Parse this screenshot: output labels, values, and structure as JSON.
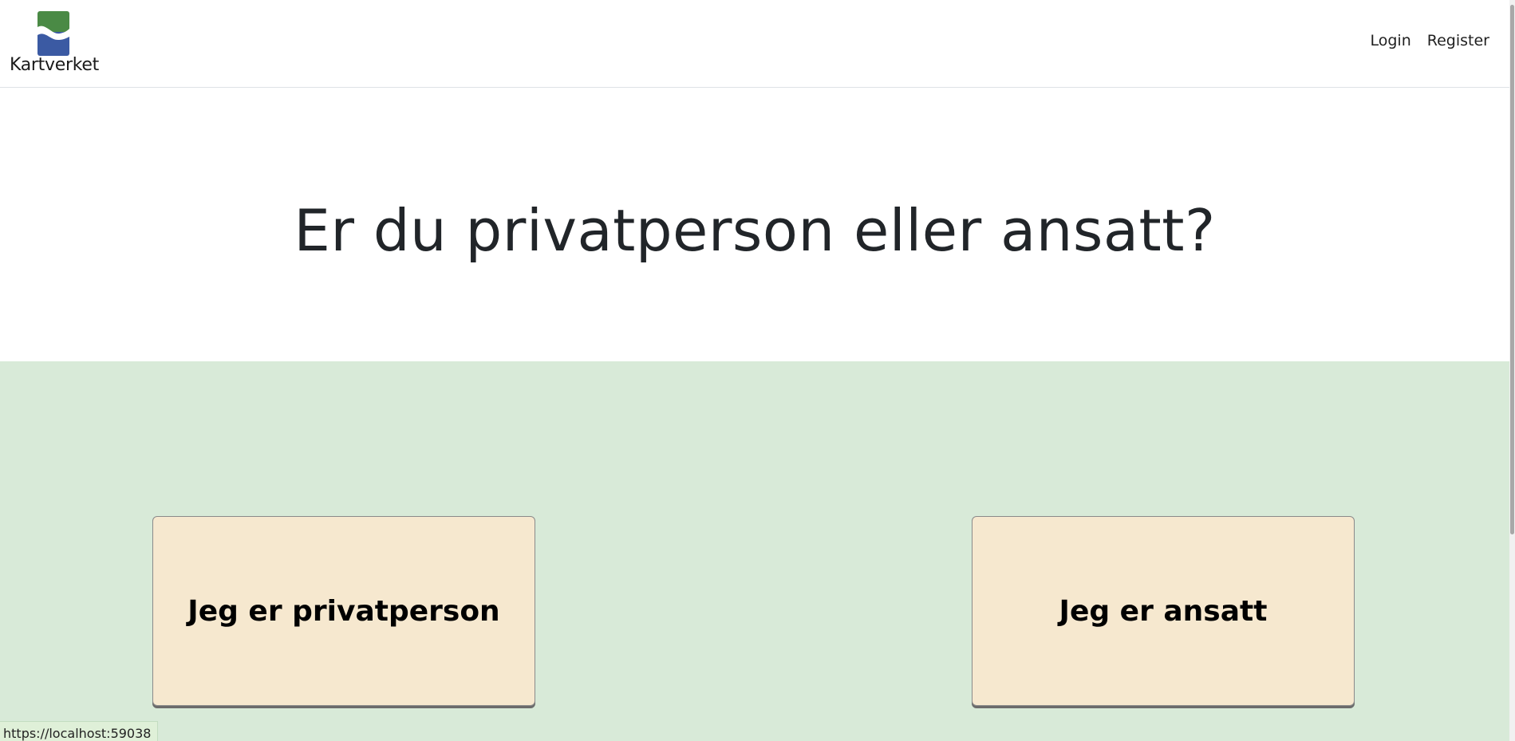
{
  "header": {
    "brand_name": "Kartverket",
    "nav": {
      "login": "Login",
      "register": "Register"
    }
  },
  "hero": {
    "title": "Er du privatperson eller ansatt?"
  },
  "choices": {
    "private_label": "Jeg er privatperson",
    "employee_label": "Jeg er ansatt"
  },
  "status_bar": {
    "url": "https://localhost:59038"
  },
  "colors": {
    "logo_green": "#4a8a45",
    "logo_blue": "#3b5aa3",
    "section_bg": "#d8ead8",
    "button_bg": "#f6e8cf"
  }
}
